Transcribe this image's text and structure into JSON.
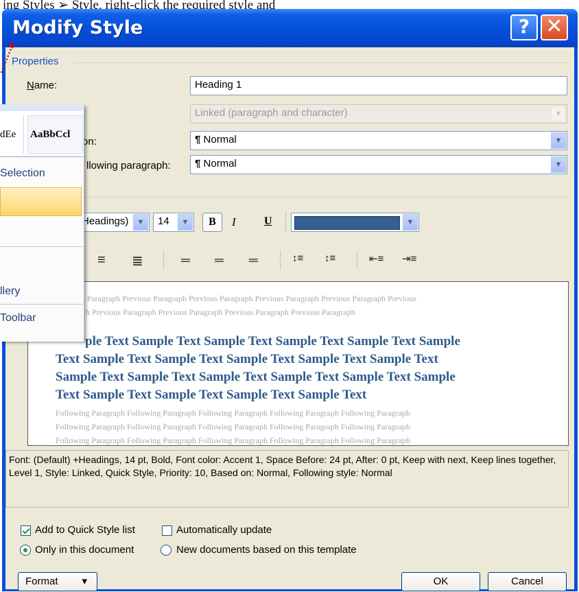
{
  "background_doc": {
    "top_text": "ing Styles ➢ Style, right-click the required style and",
    "right_edge_text": ":"
  },
  "dialog": {
    "title": "Modify Style",
    "help_glyph": "?",
    "close_glyph": "✕"
  },
  "properties": {
    "group_label": "Properties",
    "name_label": "Name:",
    "name_value": "Heading 1",
    "style_type_value": "Linked (paragraph and character)",
    "based_on_label_partial": "on:",
    "based_on_value": "Normal",
    "following_label_partial": "llowing paragraph:",
    "following_value": "Normal",
    "pilcrow": "¶"
  },
  "formatting": {
    "font_value": "Headings)",
    "size_value": "14",
    "bold": "B",
    "italic": "I",
    "underline": "U",
    "color_hex": "#365f91",
    "align_left_icon": "≡",
    "align_right_icon": "≣",
    "justify_icon": "≣",
    "spacing_icons": [
      "═",
      "═",
      "═"
    ],
    "line_spacing_icons": [
      "↕≡",
      "↕≡"
    ],
    "indent_icons": [
      "⇤≡",
      "⇥≡"
    ]
  },
  "preview": {
    "previous_line1": "s Paragraph Previous Paragraph Previous Paragraph Previous Paragraph Previous Paragraph Previous",
    "previous_line2": "h Previous Paragraph Previous Paragraph Previous Paragraph Previous Paragraph",
    "sample_line1": "ple Text Sample Text Sample Text Sample Text Sample Text Sample",
    "sample_line2": "Text Sample Text Sample Text Sample Text Sample Text Sample Text",
    "sample_line3": "Sample Text Sample Text Sample Text Sample Text Sample Text Sample",
    "sample_line4": "Text Sample Text Sample Text Sample Text Sample Text",
    "following_line1": "Following Paragraph Following Paragraph Following Paragraph Following Paragraph Following Paragraph",
    "following_line2": "Following Paragraph Following Paragraph Following Paragraph Following Paragraph Following Paragraph",
    "following_line3": "Following Paragraph Following Paragraph Following Paragraph Following Paragraph Following Paragraph"
  },
  "description": "Font: (Default) +Headings, 14 pt, Bold, Font color: Accent 1, Space Before:  24 pt, After:  0 pt, Keep with next, Keep lines together, Level 1, Style: Linked, Quick Style, Priority: 10, Based on: Normal, Following style: Normal",
  "options": {
    "add_quick_style_label": "Add to Quick Style list",
    "add_quick_style_checked": true,
    "auto_update_label": "Automatically update",
    "auto_update_checked": false,
    "only_this_doc_label": "Only in this document",
    "new_docs_label": "New documents based on this template",
    "selected_scope": "only_this_doc"
  },
  "buttons": {
    "format": "Format",
    "format_arrow": "▾",
    "ok": "OK",
    "cancel": "Cancel"
  },
  "ribbon_menu": {
    "gallery_item1": "dEe",
    "gallery_item2": "AaBbCcl",
    "item_selection": "Selection",
    "item_gallery": "llery",
    "item_toolbar": "Toolbar"
  }
}
